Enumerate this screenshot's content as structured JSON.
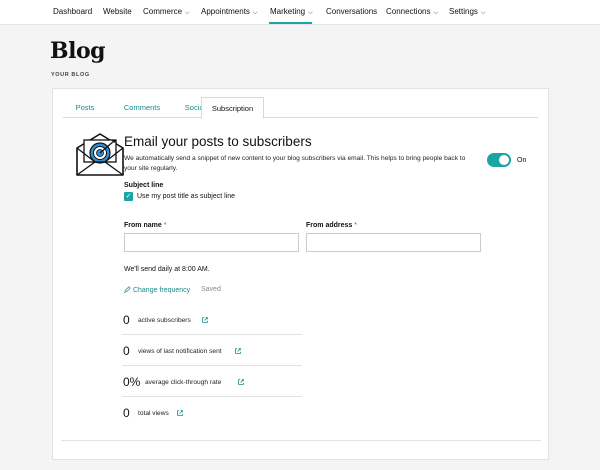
{
  "nav": {
    "items": [
      {
        "label": "Dashboard",
        "chevron": false
      },
      {
        "label": "Website",
        "chevron": false
      },
      {
        "label": "Commerce",
        "chevron": true
      },
      {
        "label": "Appointments",
        "chevron": true
      },
      {
        "label": "Marketing",
        "chevron": true,
        "active": true
      },
      {
        "label": "Conversations",
        "chevron": false
      },
      {
        "label": "Connections",
        "chevron": true
      },
      {
        "label": "Settings",
        "chevron": true
      }
    ],
    "active_color": "#1aa5a5"
  },
  "page": {
    "title": "Blog",
    "subtitle": "YOUR BLOG"
  },
  "tabs": [
    {
      "label": "Posts"
    },
    {
      "label": "Comments"
    },
    {
      "label": "Social"
    },
    {
      "label": "Subscription",
      "active": true
    }
  ],
  "subscription": {
    "icon": "email-target-icon",
    "title": "Email your posts to subscribers",
    "description": "We automatically send a snippet of new content to your blog subscribers via email. This helps to bring people back to your site regularly.",
    "toggle_on": true,
    "toggle_label": "On",
    "subject_line_label": "Subject line",
    "use_title_checked": true,
    "use_title_label": "Use my post title as subject line",
    "from_name_label": "From name",
    "from_name_value": "",
    "from_address_label": "From address",
    "from_address_value": "",
    "required_mark": "*",
    "schedule_text": "We'll send daily at 8:00 AM.",
    "change_frequency_label": "Change frequency",
    "saved_label": "Saved"
  },
  "stats": [
    {
      "value": "0",
      "label": "active subscribers"
    },
    {
      "value": "0",
      "label": "views of last notification sent"
    },
    {
      "value": "0%",
      "label": "average click-through rate"
    },
    {
      "value": "0",
      "label": "total views"
    }
  ]
}
